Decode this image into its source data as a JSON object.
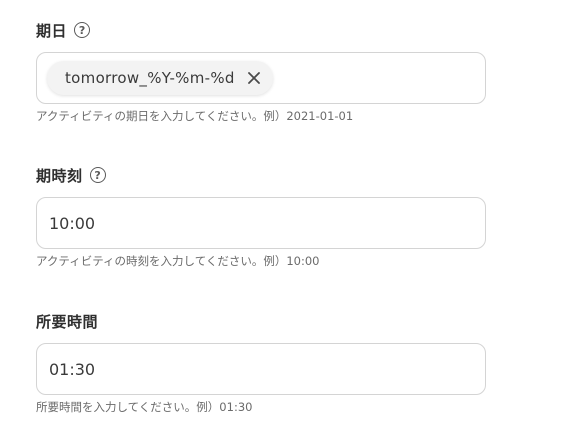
{
  "fields": {
    "due_date": {
      "label": "期日",
      "help_icon": "?",
      "chip": "tomorrow_%Y-%m-%d",
      "hint": "アクティビティの期日を入力してください。例）2021-01-01"
    },
    "due_time": {
      "label": "期時刻",
      "help_icon": "?",
      "value": "10:00",
      "hint": "アクティビティの時刻を入力してください。例）10:00"
    },
    "duration": {
      "label": "所要時間",
      "value": "01:30",
      "hint": "所要時間を入力してください。例）01:30"
    }
  },
  "icons": {
    "help": "question-circle-icon",
    "chip_close": "close-icon"
  },
  "colors": {
    "border": "#d4d4d4",
    "chip_bg": "#f3f3f3",
    "label": "#2f2f2f",
    "hint": "#6b6b6b"
  }
}
